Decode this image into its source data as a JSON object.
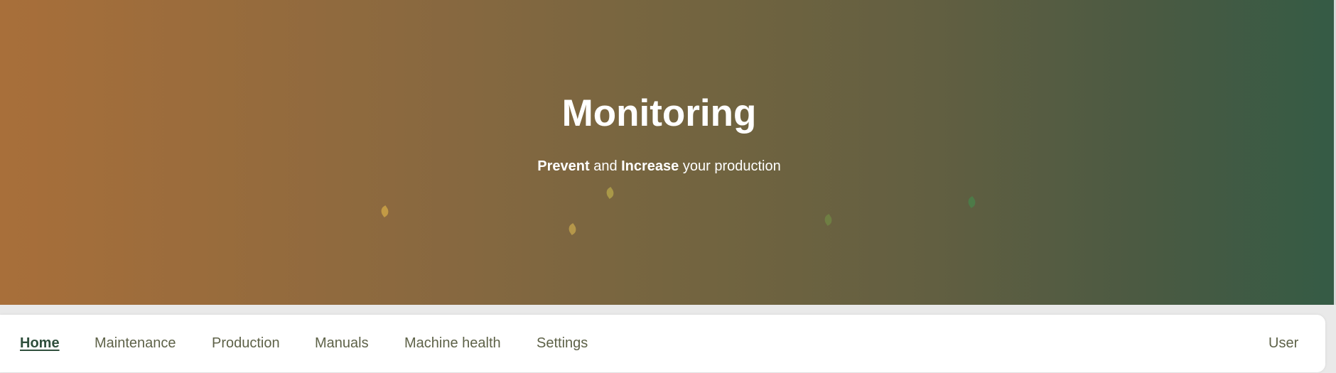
{
  "hero": {
    "title": "Monitoring",
    "subtitle": {
      "strong1": "Prevent",
      "text1": " and ",
      "strong2": "Increase",
      "text2": " your production"
    },
    "gradient_start": "#a86f3a",
    "gradient_end": "#355b45",
    "leaf_colors": [
      "#c29a45",
      "#a99848",
      "#b5974a",
      "#6f7e43",
      "#4d7a48"
    ]
  },
  "nav": {
    "items": [
      {
        "label": "Home",
        "active": true
      },
      {
        "label": "Maintenance",
        "active": false
      },
      {
        "label": "Production",
        "active": false
      },
      {
        "label": "Manuals",
        "active": false
      },
      {
        "label": "Machine health",
        "active": false
      },
      {
        "label": "Settings",
        "active": false
      }
    ],
    "user_label": "User",
    "active_color": "#2f4f3c",
    "text_color": "#5e6248"
  }
}
